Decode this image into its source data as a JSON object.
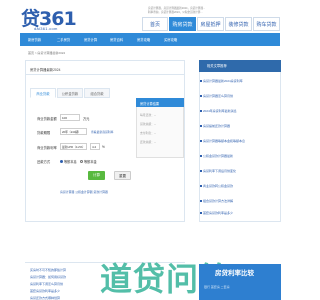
{
  "header": {
    "logo_text": "贷361",
    "logo_sub": "dai361.com",
    "top_links_1": "房贷计算器，房贷计算器最新2024，房贷计算器...",
    "top_links_2": "利率查询，房贷计算器2024，公积金贷款计算..."
  },
  "nav": {
    "tabs": [
      "首页",
      "购房贷款",
      "房屋抵押",
      "装修贷款",
      "购车贷款"
    ],
    "active_index": 1
  },
  "subnav": {
    "items": [
      "新房贷款",
      "二手房贷",
      "房贷计算",
      "房贷百科",
      "房贷攻略",
      "买房攻略"
    ]
  },
  "breadcrumb": "首页 > 房贷计算器最新2024",
  "main": {
    "title": "房贷计算器最新2024",
    "form_tabs": [
      "商业贷款",
      "公积金贷款",
      "组合贷款"
    ],
    "fields": {
      "loan_amount_label": "商业贷款金额",
      "loan_amount_value": "100",
      "loan_amount_unit": "万元",
      "term_label": "贷款期限",
      "term_value": "20年（240期）",
      "rate_link": "查看最新商贷利率",
      "rate_label": "商业贷款利率",
      "rate_select": "最新LPR（4.2%）",
      "rate_value": "4.2",
      "rate_unit": "%",
      "repay_label": "还款方式",
      "repay_option_1": "等额本息",
      "repay_option_2": "等额本金"
    },
    "buttons": {
      "calculate": "计算",
      "reset": "重置"
    },
    "links_line": "房贷计算器  公积金计算器  贷款计算器",
    "result": {
      "title": "房贷计算结果",
      "lines": [
        "每月还款：--",
        "贷款总额：--",
        "支付利息：--",
        "还款总额：--"
      ]
    }
  },
  "side": {
    "title": "相关文章推荐",
    "items": [
      "房贷计算器最新2024房贷利率",
      "房贷计算器怎么算月供",
      "2024年房贷利率最新消息",
      "房贷提前还款计算器",
      "房贷计算器等额本金和等额本息",
      "公积金贷款计算器最新",
      "房贷利率下调后月供变化",
      "商业贷款转公积金贷款",
      "组合贷款计算方法详解",
      "首套房贷款利率是多少"
    ]
  },
  "bottom": {
    "items": [
      "买房时不可不知的那些计算",
      "房贷计算器：如何用好贷款",
      "房贷利率下调怎么算月供",
      "首套房贷款利率是多少",
      "房贷还款方式哪种划算"
    ]
  },
  "banner": {
    "title": "房贷利率比较",
    "caption": "银行  首套房  二套房"
  },
  "watermark": "道贷问答",
  "colors": {
    "brand_blue": "#2f8ad8",
    "dark_blue": "#2e5fae",
    "green": "#58b93f"
  }
}
